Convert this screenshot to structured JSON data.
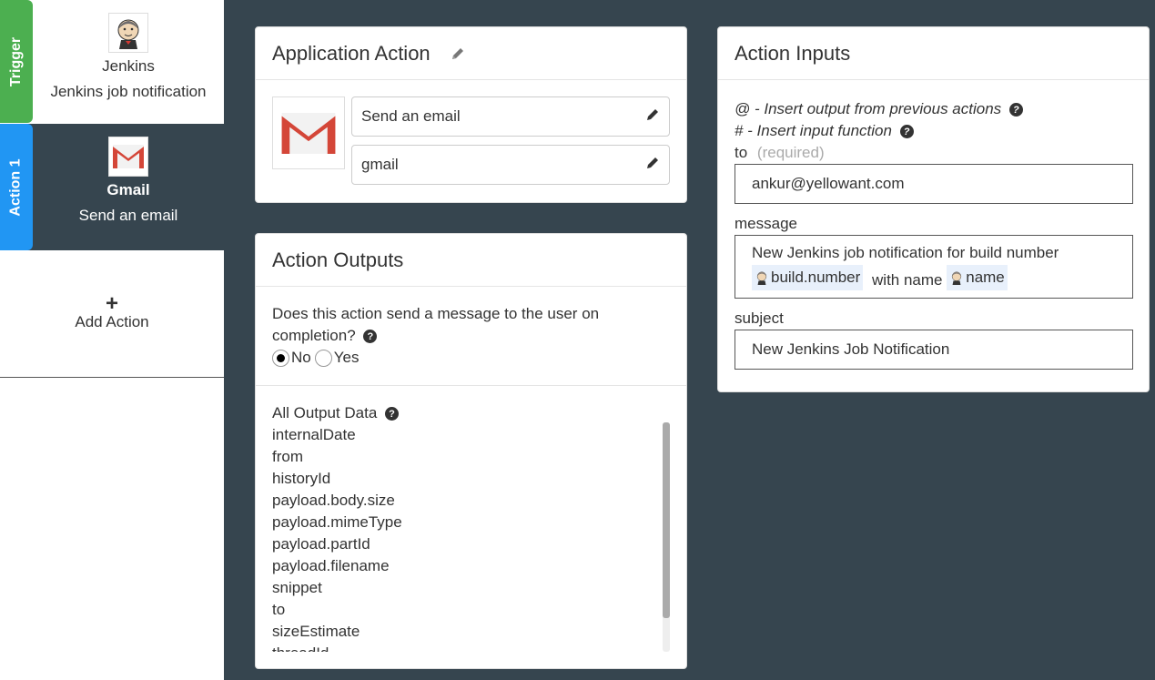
{
  "sidebar": {
    "trigger": {
      "tab": "Trigger",
      "app": "Jenkins",
      "desc": "Jenkins job notification",
      "icon": "jenkins-icon"
    },
    "action": {
      "tab": "Action 1",
      "app": "Gmail",
      "desc": "Send an email",
      "icon": "gmail-icon"
    },
    "add_action": "Add Action"
  },
  "app_action": {
    "title": "Application Action",
    "action_value": "Send an email",
    "app_value": "gmail"
  },
  "outputs": {
    "title": "Action Outputs",
    "question": "Does this action send a message to the user on completion?",
    "options": [
      "No",
      "Yes"
    ],
    "selected": "No",
    "list_header": "All Output Data",
    "items": [
      "internalDate",
      "from",
      "historyId",
      "payload.body.size",
      "payload.mimeType",
      "payload.partId",
      "payload.filename",
      "snippet",
      "to",
      "sizeEstimate",
      "threadId"
    ]
  },
  "inputs": {
    "title": "Action Inputs",
    "hint_at": "@ - Insert output from previous actions",
    "hint_hash": "# - Insert input function",
    "to_label": "to",
    "to_required": "(required)",
    "to_value": "ankur@yellowant.com",
    "message_label": "message",
    "message_text_1": "New Jenkins job notification for build number",
    "message_token_1": "build.number",
    "message_text_2": "with name",
    "message_token_2": "name",
    "subject_label": "subject",
    "subject_value": "New Jenkins Job Notification"
  },
  "colors": {
    "trigger": "#4caf50",
    "action": "#2196f3",
    "background": "#36454f"
  }
}
